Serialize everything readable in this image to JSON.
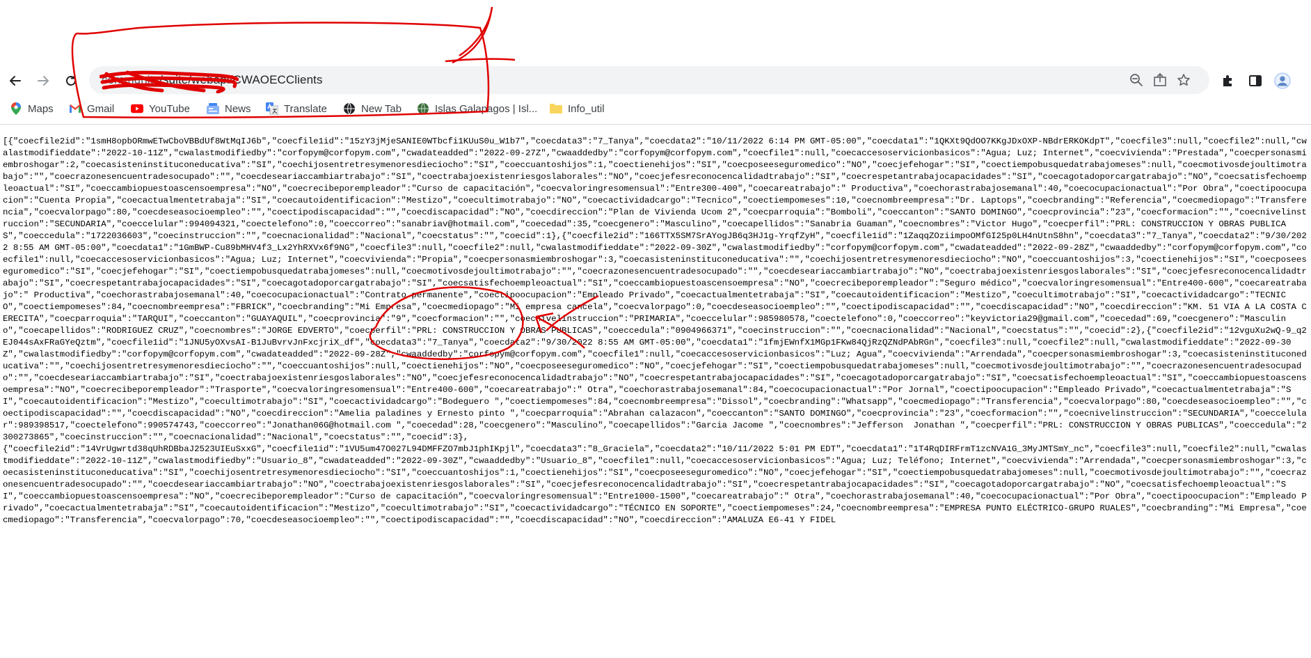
{
  "browser": {
    "url": {
      "host": "community",
      "path": "/suite/webapi/CWAOECClients"
    },
    "icons": {
      "back": "arrow-left-icon",
      "forward": "arrow-right-icon",
      "reload": "reload-icon",
      "zoom": "zoom-out-icon",
      "share": "share-icon",
      "star": "star-icon",
      "extensions": "puzzle-icon",
      "sidepanel": "side-panel-icon",
      "profile": "profile-icon"
    }
  },
  "bookmarks": [
    {
      "label": "Maps",
      "icon": "maps-pin-icon"
    },
    {
      "label": "Gmail",
      "icon": "gmail-icon"
    },
    {
      "label": "YouTube",
      "icon": "youtube-icon"
    },
    {
      "label": "News",
      "icon": "news-icon"
    },
    {
      "label": "Translate",
      "icon": "translate-icon"
    },
    {
      "label": "New Tab",
      "icon": "globe-icon"
    },
    {
      "label": "Islas Galapagos | Isl...",
      "icon": "globe-icon"
    },
    {
      "label": "Info_util",
      "icon": "folder-icon"
    }
  ],
  "content": {
    "raw_json": "[{\"coecfile2id\":\"1smH8opbORmwETwCboVBBdUf8WtMqIJ6b\",\"coecfile1id\":\"15zY3jMjeSANIE0WTbcfi1KUuS0u_W1b7\",\"coecdata3\":\"7_Tanya\",\"coecdata2\":\"10/11/2022 6:14 PM GMT-05:00\",\"coecdata1\":\"1QKXt9QdOO7KKgJDxOXP-NBdrERKOKdpT\",\"coecfile3\":null,\"coecfile2\":null,\"cwalastmodifieddate\":\"2022-10-11Z\",\"cwalastmodifiedby\":\"corfopym@corfopym.com\",\"cwadateadded\":\"2022-09-27Z\",\"cwaaddedby\":\"corfopym@corfopym.com\",\"coecfile1\":null,\"coecaccesoservicionbasicos\":\"Agua; Luz; Internet\",\"coecvivienda\":\"Prestada\",\"coecpersonasmiembroshogar\":2,\"coecasisteninstituconeducativa\":\"SI\",\"coechijosentretresymenoresdieciocho\":\"SI\",\"coeccuantoshijos\":1,\"coectienehijos\":\"SI\",\"coecposeeseguromedico\":\"NO\",\"coecjefehogar\":\"SI\",\"coectiempobusquedatrabajomeses\":null,\"coecmotivosdejoultimotrabajo\":\"\",\"coecrazonesencuentradesocupado\":\"\",\"coecdeseariaccambiartrabajo\":\"SI\",\"coectrabajoexistenriesgoslaborales\":\"NO\",\"coecjefesreconocencalidadtrabajo\":\"SI\",\"coecrespetantrabajocapacidades\":\"SI\",\"coecagotadoporcargatrabajo\":\"NO\",\"coecsatisfechoempleoactual\":\"SI\",\"coeccambiopuestoascensoempresa\":\"NO\",\"coecrecibeporempleador\":\"Curso de capacitación\",\"coecvaloringresomensual\":\"Entre300-400\",\"coecareatrabajo\":\" Productiva\",\"coechorastrabajosemanal\":40,\"coecocupacionactual\":\"Por Obra\",\"coectipoocupacion\":\"Cuenta Propia\",\"coecactualmentetrabaja\":\"SI\",\"coecautoidentificacion\":\"Mestizo\",\"coecultimotrabajo\":\"NO\",\"coecactividadcargo\":\"Tecnico\",\"coectiempomeses\":10,\"coecnombreempresa\":\"Dr. Laptops\",\"coecbranding\":\"Referencia\",\"coecmediopago\":\"Transferencia\",\"coecvalorpago\":80,\"coecdeseasocioempleo\":\"\",\"coectipodiscapacidad\":\"\",\"coecdiscapacidad\":\"NO\",\"coecdireccion\":\"Plan de Vivienda Ucom 2\",\"coecparroquia\":\"Bomboli\",\"coeccanton\":\"SANTO DOMINGO\",\"coecprovincia\":\"23\",\"coecformacion\":\"\",\"coecnivelinstruccion\":\"SECUNDARIA\",\"coeccelular\":994094321,\"coectelefono\":0,\"coeccorreo\":\"sanabriav@hotmail.com\",\"coecedad\":35,\"coecgenero\":\"Masculino\",\"coecapellidos\":\"Sanabria Guaman\",\"coecnombres\":\"Victor Hugo\",\"coecperfil\":\"PRL: CONSTRUCCION Y OBRAS PUBLICAS\",\"coeccedula\":\"1722036603\",\"coecinstruccion\":\"\",\"coecnacionalidad\":\"Nacional\",\"coecstatus\":\"\",\"coecid\":1},{\"coecfile2id\":\"166TTX5SM7SrAYogJB6q3HJ1g-YrqfZyH\",\"coecfile1id\":\"1ZaqqZOziimpoOMfGI25p0LH4nUtnS8hn\",\"coecdata3\":\"7_Tanya\",\"coecdata2\":\"9/30/2022 8:55 AM GMT-05:00\",\"coecdata1\":\"1GmBWP-Cu89bMHV4f3_Lx2YhRXVx6f9NG\",\"coecfile3\":null,\"coecfile2\":null,\"cwalastmodifieddate\":\"2022-09-30Z\",\"cwalastmodifiedby\":\"corfopym@corfopym.com\",\"cwadateadded\":\"2022-09-28Z\",\"cwaaddedby\":\"corfopym@corfopym.com\",\"coecfile1\":null,\"coecaccesoservicionbasicos\":\"Agua; Luz; Internet\",\"coecvivienda\":\"Propia\",\"coecpersonasmiembroshogar\":3,\"coecasisteninstituconeducativa\":\"\",\"coechijosentretresymenoresdieciocho\":\"NO\",\"coeccuantoshijos\":3,\"coectienehijos\":\"SI\",\"coecposeeseguromedico\":\"SI\",\"coecjefehogar\":\"SI\",\"coectiempobusquedatrabajomeses\":null,\"coecmotivosdejoultimotrabajo\":\"\",\"coecrazonesencuentradesocupado\":\"\",\"coecdeseariaccambiartrabajo\":\"NO\",\"coectrabajoexistenriesgoslaborales\":\"SI\",\"coecjefesreconocencalidadtrabajo\":\"SI\",\"coecrespetantrabajocapacidades\":\"SI\",\"coecagotadoporcargatrabajo\":\"SI\",\"coecsatisfechoempleoactual\":\"SI\",\"coeccambiopuestoascensoempresa\":\"NO\",\"coecrecibeporempleador\":\"Seguro médico\",\"coecvaloringresomensual\":\"Entre400-600\",\"coecareatrabajo\":\" Productiva\",\"coechorastrabajosemanal\":40,\"coecocupacionactual\":\"Contrato permanente\",\"coectipoocupacion\":\"Empleado Privado\",\"coecactualmentetrabaja\":\"SI\",\"coecautoidentificacion\":\"Mestizo\",\"coecultimotrabajo\":\"SI\",\"coecactividadcargo\":\"TECNICO\",\"coectiempomeses\":84,\"coecnombreempresa\":\"FBRICK\",\"coecbranding\":\"Mi Empresa\",\"coecmediopago\":\"Mi empresa cancela\",\"coecvalorpago\":0,\"coecdeseasocioempleo\":\"\",\"coectipodiscapacidad\":\"\",\"coecdiscapacidad\":\"NO\",\"coecdireccion\":\"KM. 51 VIA A LA COSTA CERECITA\",\"coecparroquia\":\"TARQUI\",\"coeccanton\":\"GUAYAQUIL\",\"coecprovincia\":\"9\",\"coecformacion\":\"\",\"coecnivelinstruccion\":\"PRIMARIA\",\"coeccelular\":985980578,\"coectelefono\":0,\"coeccorreo\":\"keyvictoria29@gmail.com\",\"coecedad\":69,\"coecgenero\":\"Masculino\",\"coecapellidos\":\"RODRIGUEZ CRUZ\",\"coecnombres\":\"JORGE EDVERTO\",\"coecperfil\":\"PRL: CONSTRUCCION Y OBRAS PUBLICAS\",\"coeccedula\":\"0904966371\",\"coecinstruccion\":\"\",\"coecnacionalidad\":\"Nacional\",\"coecstatus\":\"\",\"coecid\":2},{\"coecfile2id\":\"12vguXu2wQ-9_q2EJ044sAxFRaGYeQztm\",\"coecfile1id\":\"1JNU5yOXvsAI-B1JuBvrvJnFxcjriX_df\",\"coecdata3\":\"7_Tanya\",\"coecdata2\":\"9/30/2022 8:55 AM GMT-05:00\",\"coecdata1\":\"1fmjEWnfX1MGp1FKw84QjRzQZNdPAbRGn\",\"coecfile3\":null,\"coecfile2\":null,\"cwalastmodifieddate\":\"2022-09-30Z\",\"cwalastmodifiedby\":\"corfopym@corfopym.com\",\"cwadateadded\":\"2022-09-28Z\",\"cwaaddedby\":\"corfopym@corfopym.com\",\"coecfile1\":null,\"coecaccesoservicionbasicos\":\"Luz; Agua\",\"coecvivienda\":\"Arrendada\",\"coecpersonasmiembroshogar\":3,\"coecasisteninstituconeducativa\":\"\",\"coechijosentretresymenoresdieciocho\":\"\",\"coeccuantoshijos\":null,\"coectienehijos\":\"NO\",\"coecposeeseguromedico\":\"NO\",\"coecjefehogar\":\"SI\",\"coectiempobusquedatrabajomeses\":null,\"coecmotivosdejoultimotrabajo\":\"\",\"coecrazonesencuentradesocupado\":\"\",\"coecdeseariaccambiartrabajo\":\"SI\",\"coectrabajoexistenriesgoslaborales\":\"NO\",\"coecjefesreconocencalidadtrabajo\":\"NO\",\"coecrespetantrabajocapacidades\":\"SI\",\"coecagotadoporcargatrabajo\":\"SI\",\"coecsatisfechoempleoactual\":\"SI\",\"coeccambiopuestoascensoempresa\":\"NO\",\"coecrecibeporempleador\":\"Trasporte\",\"coecvaloringresomensual\":\"Entre400-600\",\"coecareatrabajo\":\" Otra\",\"coechorastrabajosemanal\":84,\"coecocupacionactual\":\"Por Jornal\",\"coectipoocupacion\":\"Empleado Privado\",\"coecactualmentetrabaja\":\"SI\",\"coecautoidentificacion\":\"Mestizo\",\"coecultimotrabajo\":\"SI\",\"coecactividadcargo\":\"Bodeguero \",\"coectiempomeses\":84,\"coecnombreempresa\":\"Dissol\",\"coecbranding\":\"Whatsapp\",\"coecmediopago\":\"Transferencia\",\"coecvalorpago\":80,\"coecdeseasocioempleo\":\"\",\"coectipodiscapacidad\":\"\",\"coecdiscapacidad\":\"NO\",\"coecdireccion\":\"Amelia paladines y Ernesto pinto \",\"coecparroquia\":\"Abrahan calazacon\",\"coeccanton\":\"SANTO DOMINGO\",\"coecprovincia\":\"23\",\"coecformacion\":\"\",\"coecnivelinstruccion\":\"SECUNDARIA\",\"coeccelular\":989398517,\"coectelefono\":990574743,\"coeccorreo\":\"Jonathan06G@hotmail.com \",\"coecedad\":28,\"coecgenero\":\"Masculino\",\"coecapellidos\":\"Garcia Jacome \",\"coecnombres\":\"Jefferson  Jonathan \",\"coecperfil\":\"PRL: CONSTRUCCION Y OBRAS PUBLICAS\",\"coeccedula\":\"2300273865\",\"coecinstruccion\":\"\",\"coecnacionalidad\":\"Nacional\",\"coecstatus\":\"\",\"coecid\":3},\n{\"coecfile2id\":\"14VrUgwrtd38qUhRDBbaJ2523UIEuSxxG\",\"coecfile1id\":\"1VU5um47O027L94DMFFZO7mbJ1phIKpjl\",\"coecdata3\":\"8_Graciela\",\"coecdata2\":\"10/11/2022 5:01 PM EDT\",\"coecdata1\":\"1T4RqDIRFrmT1zcNVA1G_3MyJMTSmY_nc\",\"coecfile3\":null,\"coecfile2\":null,\"cwalastmodifieddate\":\"2022-10-11Z\",\"cwalastmodifiedby\":\"Usuario_8\",\"cwadateadded\":\"2022-09-30Z\",\"cwaaddedby\":\"Usuario_8\",\"coecfile1\":null,\"coecaccesoservicionbasicos\":\"Agua; Luz; Teléfono; Internet\",\"coecvivienda\":\"Arrendada\",\"coecpersonasmiembroshogar\":3,\"coecasisteninstituconeducativa\":\"SI\",\"coechijosentretresymenoresdieciocho\":\"SI\",\"coeccuantoshijos\":1,\"coectienehijos\":\"SI\",\"coecposeeseguromedico\":\"NO\",\"coecjefehogar\":\"SI\",\"coectiempobusquedatrabajomeses\":null,\"coecmotivosdejoultimotrabajo\":\"\",\"coecrazonesencuentradesocupado\":\"\",\"coecdeseariaccambiartrabajo\":\"NO\",\"coectrabajoexistenriesgoslaborales\":\"SI\",\"coecjefesreconocencalidadtrabajo\":\"SI\",\"coecrespetantrabajocapacidades\":\"SI\",\"coecagotadoporcargatrabajo\":\"NO\",\"coecsatisfechoempleoactual\":\"SI\",\"coeccambiopuestoascensoempresa\":\"NO\",\"coecrecibeporempleador\":\"Curso de capacitación\",\"coecvaloringresomensual\":\"Entre1000-1500\",\"coecareatrabajo\":\" Otra\",\"coechorastrabajosemanal\":40,\"coecocupacionactual\":\"Por Obra\",\"coectipoocupacion\":\"Empleado Privado\",\"coecactualmentetrabaja\":\"SI\",\"coecautoidentificacion\":\"Mestizo\",\"coecultimotrabajo\":\"SI\",\"coecactividadcargo\":\"TÉCNICO EN SOPORTE\",\"coectiempomeses\":24,\"coecnombreempresa\":\"EMPRESA PUNTO ELÉCTRICO-GRUPO RUALES\",\"coecbranding\":\"Mi Empresa\",\"coecmediopago\":\"Transferencia\",\"coecvalorpago\":70,\"coecdeseasocioempleo\":\"\",\"coectipodiscapacidad\":\"\",\"coecdiscapacidad\":\"NO\",\"coecdireccion\":\"AMALUZA E6-41 Y FIDEL"
  },
  "colors": {
    "annotation": "#e00000",
    "omnibox": "#f1f3f4",
    "text": "#000000"
  }
}
